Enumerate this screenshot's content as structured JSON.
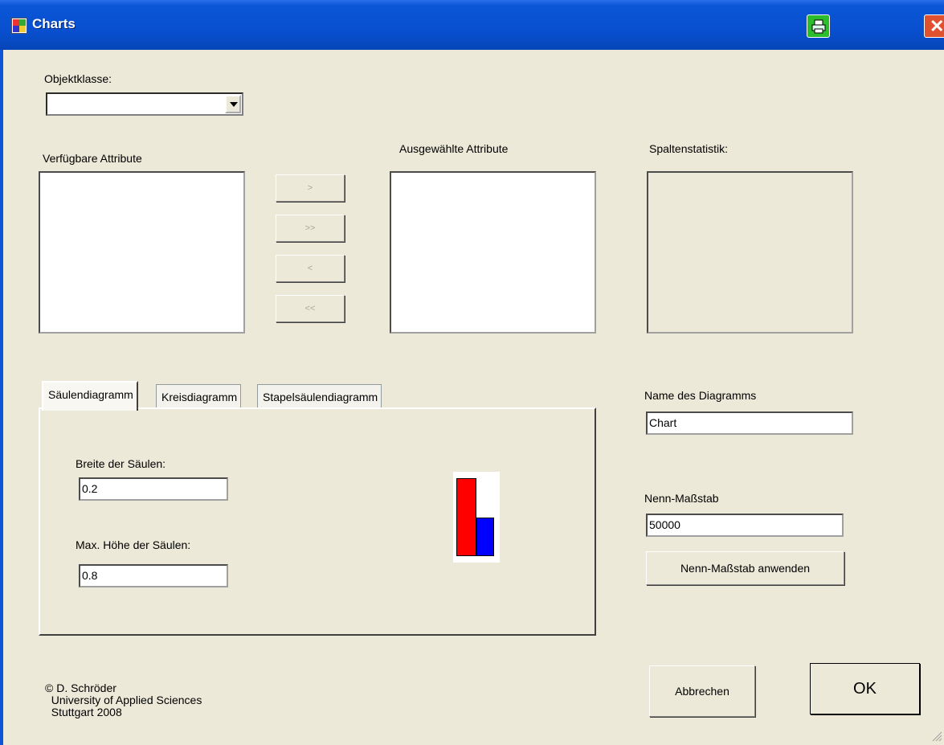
{
  "window": {
    "title": "Charts"
  },
  "titlebar": {
    "print_icon": "printer-icon",
    "close_symbol": "✕"
  },
  "objektklasse": {
    "label": "Objektklasse:",
    "value": ""
  },
  "available": {
    "label": "Verfügbare Attribute",
    "items": []
  },
  "selected": {
    "label": "Ausgewählte Attribute",
    "items": []
  },
  "statistik": {
    "label": "Spaltenstatistik:"
  },
  "transfer_buttons": {
    "add": ">",
    "add_all": ">>",
    "remove": "<",
    "remove_all": "<<"
  },
  "tabs": [
    {
      "label": "Säulendiagramm",
      "active": true
    },
    {
      "label": "Kreisdiagramm",
      "active": false
    },
    {
      "label": "Stapelsäulendiagramm",
      "active": false
    }
  ],
  "saeulen": {
    "breite_label": "Breite der Säulen:",
    "breite_value": "0.2",
    "hoehe_label": "Max. Höhe der Säulen:",
    "hoehe_value": "0.8",
    "preview_colors": {
      "bar1": "#ff0000",
      "bar2": "#0000ff"
    },
    "preview_levels": {
      "bar1": 1.0,
      "bar2": 0.5
    }
  },
  "diagram_name": {
    "label": "Name des Diagramms",
    "value": "Chart"
  },
  "nenn_massstab": {
    "label": "Nenn-Maßstab",
    "value": "50000",
    "apply_button": "Nenn-Maßstab anwenden"
  },
  "footer": {
    "copyright": "© D. Schröder\n  University of Applied Sciences\n  Stuttgart 2008",
    "cancel_button": "Abbrechen",
    "ok_button": "OK"
  },
  "colors": {
    "titlebar": "#0850d0",
    "window_bg": "#ece9d8",
    "close_button": "#e0512f",
    "print_button": "#2cbd2c"
  }
}
